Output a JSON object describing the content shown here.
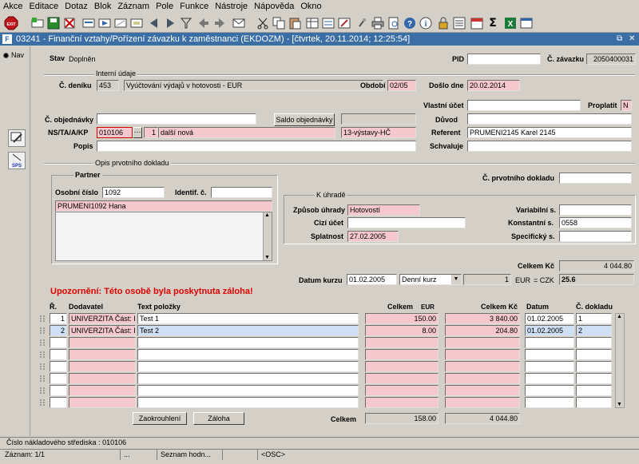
{
  "menu": [
    "Akce",
    "Editace",
    "Dotaz",
    "Blok",
    "Záznam",
    "Pole",
    "Funkce",
    "Nástroje",
    "Nápověda",
    "Okno"
  ],
  "toolbar_icons": [
    "exit-icon",
    "insert-record-icon",
    "save-icon",
    "delete-icon",
    "enter-query-icon",
    "execute-query-icon",
    "clear-icon",
    "filter-icon",
    "previous-icon",
    "next-icon",
    "mail-icon",
    "cut-icon",
    "copy-icon",
    "paste-icon",
    "print-icon",
    "help-icon",
    "calendar-icon",
    "sum-icon",
    "excel-icon",
    "window-icon"
  ],
  "window": {
    "title": "03241 - Finanční vztahy/Pořízení závazku k zaměstnanci (EKDOZM) - [čtvrtek, 20.11.2014; 12:25:54]"
  },
  "nav": {
    "label": "Nav",
    "sps_label": "SPS"
  },
  "header": {
    "stav_label": "Stav",
    "stav_value": "Doplněn",
    "pid_label": "PID",
    "pid_value": "",
    "zavazku_label": "Č. závazku",
    "zavazku_value": "2050400031"
  },
  "interni": {
    "section_label": "Interní údaje",
    "denik_label": "Č. deníku",
    "denik_value": "453",
    "denik_text": "Vyúčtování výdajů v hotovosti - EUR",
    "obdobi_label": "Období",
    "obdobi_value": "02/05",
    "doslo_label": "Došlo dne",
    "doslo_value": "20.02.2014",
    "vlastni_ucet_label": "Vlastní účet",
    "vlastni_ucet_value": "",
    "proplatit_label": "Proplatit",
    "proplatit_value": "N",
    "objednavky_label": "Č. objednávky",
    "objednavky_value": "",
    "saldo_button": "Saldo objednávky",
    "duvod_label": "Důvod",
    "duvod_value": "",
    "ns_label": "NS/TA/A/KP",
    "ns_value": "010106",
    "ns_btn": "···",
    "ta_value": "1",
    "ta_text": "další nová",
    "kp_value": "13-výstavy-HČ",
    "referent_label": "Referent",
    "referent_value": "PRUMENI2145 Karel 2145",
    "popis_label": "Popis",
    "popis_value": "",
    "schvaluje_label": "Schvaluje",
    "schvaluje_value": ""
  },
  "opis": {
    "section_label": "Opis prvotního dokladu",
    "prvotniho_label": "Č. prvotního dokladu",
    "prvotniho_value": "",
    "partner_label": "Partner",
    "osobni_label": "Osobní číslo",
    "osobni_value": "1092",
    "identif_label": "Identif. č.",
    "identif_value": "",
    "partner_name": "PRUMENI1092 Hana",
    "k_uhrade_label": "K úhradě",
    "zpusob_label": "Způsob úhrady",
    "zpusob_value": "Hotovostí",
    "variabilni_label": "Variabilní s.",
    "variabilni_value": "",
    "cizi_label": "Cizí účet",
    "cizi_value": "",
    "konstantni_label": "Konstantní s.",
    "konstantni_value": "0558",
    "splatnost_label": "Splatnost",
    "splatnost_value": "27.02.2005",
    "specificky_label": "Specifický s.",
    "specificky_value": ""
  },
  "kurz": {
    "celkem_kc_label": "Celkem Kč",
    "celkem_kc_value": "4 044.80",
    "datum_label": "Datum kurzu",
    "datum_value": "01.02.2005",
    "typ_value": "Denní kurz",
    "mnozstvi_value": "1",
    "mena": "EUR",
    "rovna_se": "= CZK",
    "kurz_value": "25.6"
  },
  "warning": "Upozornění: Této osobě byla poskytnuta záloha!",
  "table": {
    "col_r": "Ř.",
    "col_dodavatel": "Dodavatel",
    "col_text": "Text položky",
    "col_celkem": "Celkem",
    "col_eur": "EUR",
    "col_celkem_kc": "Celkem Kč",
    "col_datum": "Datum",
    "col_doklad": "Č. dokladu",
    "rows": [
      {
        "r": "1",
        "dodavatel": "UNIVERZITA Část: Ek",
        "text": "Test 1",
        "eur": "150.00",
        "kc": "3 840.00",
        "datum": "01.02.2005",
        "doklad": "1"
      },
      {
        "r": "2",
        "dodavatel": "UNIVERZITA Část: Ek",
        "text": "Test 2",
        "eur": "8.00",
        "kc": "204.80",
        "datum": "01.02.2005",
        "doklad": "2"
      }
    ],
    "empty_rows": 6,
    "zaokrouhleni_button": "Zaokrouhlení",
    "zaloha_button": "Záloha",
    "celkem_label": "Celkem",
    "celkem_eur": "158.00",
    "celkem_kc": "4 044.80"
  },
  "status": {
    "hint": "Číslo nákladového střediska : 010106",
    "zaznam": "Záznam: 1/1",
    "dots": "...",
    "seznam": "Seznam hodn...",
    "osc": "<OSC>"
  }
}
